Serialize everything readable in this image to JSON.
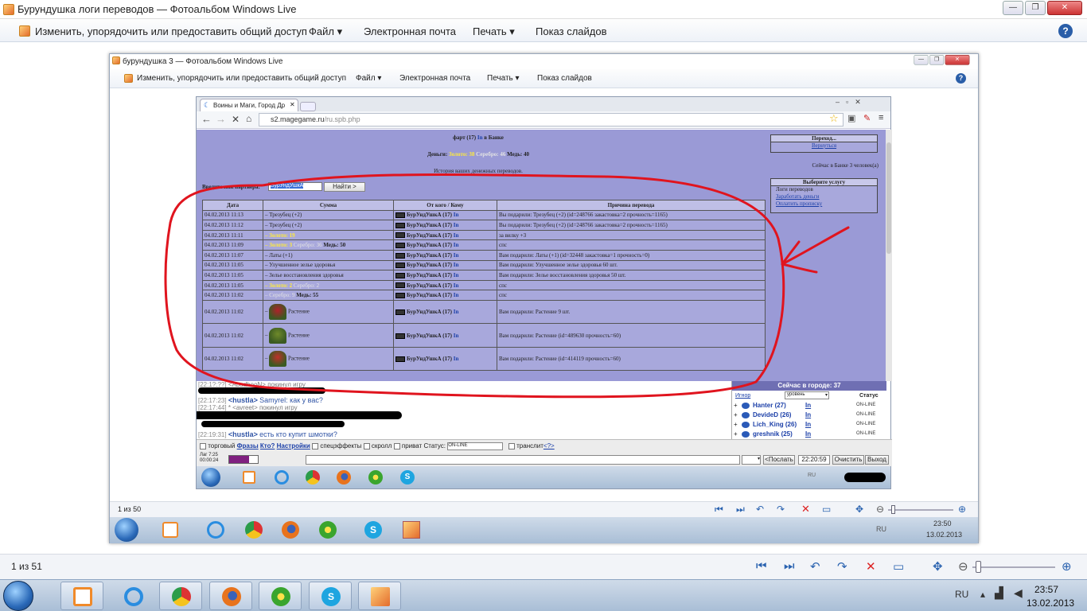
{
  "outer": {
    "title": "Бурундушка логи переводов — Фотоальбом Windows Live",
    "menu": [
      "Изменить, упорядочить или предоставить общий доступ",
      "Файл",
      "Электронная почта",
      "Печать",
      "Показ слайдов"
    ],
    "help": "?",
    "counter": "1 из 51",
    "clock_time": "23:57",
    "clock_date": "13.02.2013",
    "lang": "RU"
  },
  "inner": {
    "title": "бурундушка 3 — Фотоальбом Windows Live",
    "menu": [
      "Изменить, упорядочить или предоставить общий доступ",
      "Файл",
      "Электронная почта",
      "Печать",
      "Показ слайдов"
    ],
    "help": "?",
    "counter": "1 из 50",
    "clock_time": "23:50",
    "clock_date": "13.02.2013",
    "lang": "RU"
  },
  "browser": {
    "tab_title": "Воины и Маги, Город Др",
    "url_host": "s2.magegame.ru",
    "url_path": "/ru.spb.php"
  },
  "game": {
    "header_name": "фарт (17)",
    "header_in": "In",
    "header_place": "в Банке",
    "money_label": "Деньги:",
    "money_gold": "Золото: 38",
    "money_silver": "Серебро: 46",
    "money_copper": "Медь: 40",
    "history_title": "История ваших денежных переводов.",
    "partner_label": "Введите ник партнёра:",
    "partner_value": "БурУндУшкА",
    "find_button": "Найти >",
    "columns": [
      "Дата",
      "Сумма",
      "От кого / Кому",
      "Причина перевода"
    ],
    "rows": [
      {
        "date": "04.02.2013 11:13",
        "dc": "red",
        "sum": "– Трезубец (+2)",
        "from": "БурУндУшкА (17)",
        "in": "In",
        "reason": "Вы подарили: Трезубец (+2) (id=248766 закастовка=2 прочность=1165)"
      },
      {
        "date": "04.02.2013 11:12",
        "dc": "green",
        "sum": "– Трезубец (+2)",
        "from": "БурУндУшкА (17)",
        "in": "In",
        "reason": "Вы подарили: Трезубец (+2) (id=248766 закастовка=2 прочность=1165)"
      },
      {
        "date": "04.02.2013 11:11",
        "dc": "red",
        "sum_gold": "– Золото: 19",
        "from": "БурУндУшкА (17)",
        "in": "In",
        "reason": "за вилку +3"
      },
      {
        "date": "04.02.2013 11:09",
        "dc": "red",
        "sum_gold": "– Золото: 3",
        "sum_silver": "Серебро: 36",
        "sum_copper": "Медь: 50",
        "from": "БурУндУшкА (17)",
        "in": "In",
        "reason": "спс"
      },
      {
        "date": "04.02.2013 11:07",
        "dc": "green",
        "sum": "– Латы (+1)",
        "from": "БурУндУшкА (17)",
        "in": "In",
        "reason": "Вам подарили: Латы (+1) (id=32448 закастовка=1 прочность=0)"
      },
      {
        "date": "04.02.2013 11:05",
        "dc": "green",
        "sum": "– Улучшенное зелье здоровья",
        "from": "БурУндУшкА (17)",
        "in": "In",
        "reason": "Вам подарили: Улучшенное зелье здоровья 60 шт."
      },
      {
        "date": "04.02.2013 11:05",
        "dc": "green",
        "sum": "– Зелье восстановления здоровья",
        "from": "БурУндУшкА (17)",
        "in": "In",
        "reason": "Вам подарили: Зелье восстановления здоровья 50 шт."
      },
      {
        "date": "04.02.2013 11:05",
        "dc": "red",
        "sum_gold": "– Золото: 2",
        "sum_silver": "Серебро: 2",
        "from": "БурУндУшкА (17)",
        "in": "In",
        "reason": "спс"
      },
      {
        "date": "04.02.2013 11:02",
        "dc": "red",
        "sum_silver": "– Серебро: 9",
        "sum_copper": "Медь: 55",
        "from": "БурУндУшкА (17)",
        "in": "In",
        "reason": "спс"
      },
      {
        "date": "04.02.2013 11:02",
        "dc": "green",
        "plant": "Растение",
        "pc": "#b0202a",
        "from": "БурУндУшкА (17)",
        "in": "In",
        "reason": "Вам подарили: Растение 9 шт."
      },
      {
        "date": "04.02.2013 11:02",
        "dc": "green",
        "plant": "Растение",
        "pc": "#6f8a2a",
        "from": "БурУндУшкА (17)",
        "in": "In",
        "reason": "Вам подарили: Растение (id=489630 прочность=60)"
      },
      {
        "date": "04.02.2013 11:02",
        "dc": "green",
        "plant": "Растение",
        "pc": "#c0302a",
        "from": "БурУндУшкА (17)",
        "in": "In",
        "reason": "Вам подарили: Растение (id=414119 прочность=60)"
      }
    ],
    "transfer_box": {
      "title": "Переход...",
      "link": "Вернуться"
    },
    "people_in_bank": "Сейчас в Банке 3 человек(а)",
    "service_box": {
      "title": "Выберите услугу",
      "items": [
        "Логи переводов",
        "Заработать деньги",
        "Оплатить прописку"
      ]
    }
  },
  "chat": {
    "lines": [
      {
        "time": "[22:1?:??]",
        "text": "<AbadheoN> покинул игру"
      },
      {
        "time": "[22:17:23]",
        "nick": "<hustla>",
        "text": "Samyrel: как у вас?"
      },
      {
        "time": "[22:17:44]",
        "text": "* <avreet> покинул игру"
      },
      {
        "time": "[22:19:31]",
        "nick": "<hustla>",
        "text": "есть кто купит шмотки?"
      }
    ]
  },
  "online": {
    "header": "Сейчас в городе: 37",
    "ignore": "Игнор",
    "sort": "уровень",
    "status": "Статус",
    "players": [
      {
        "name": "Hanter (27)",
        "in": "In",
        "status": "ON-LINE"
      },
      {
        "name": "DevideD (26)",
        "in": "In",
        "status": "ON-LINE"
      },
      {
        "name": "Lich_King (26)",
        "in": "In",
        "status": "ON-LINE"
      },
      {
        "name": "greshnik (25)",
        "in": "In",
        "status": "ON-LINE"
      }
    ]
  },
  "controls": {
    "trade": "торговый",
    "phrases": "Фразы",
    "who": "Кто?",
    "settings": "Настройки",
    "effects": "спецэффекты",
    "scroll": "скролл",
    "private": "приват",
    "status_label": "Статус:",
    "status_value": "ON-LINE",
    "translit": "транслит",
    "translit_help": "<?>",
    "lag": "Лаг 7:25",
    "timer": "00:00:24",
    "send": "<Послать",
    "time": "22:20:59",
    "clear": "Очистить",
    "exit": "Выход"
  },
  "colors": {
    "page_bg": "#9a9ad6",
    "annotation": "#e0141e",
    "gold": "#ffeb3b"
  }
}
